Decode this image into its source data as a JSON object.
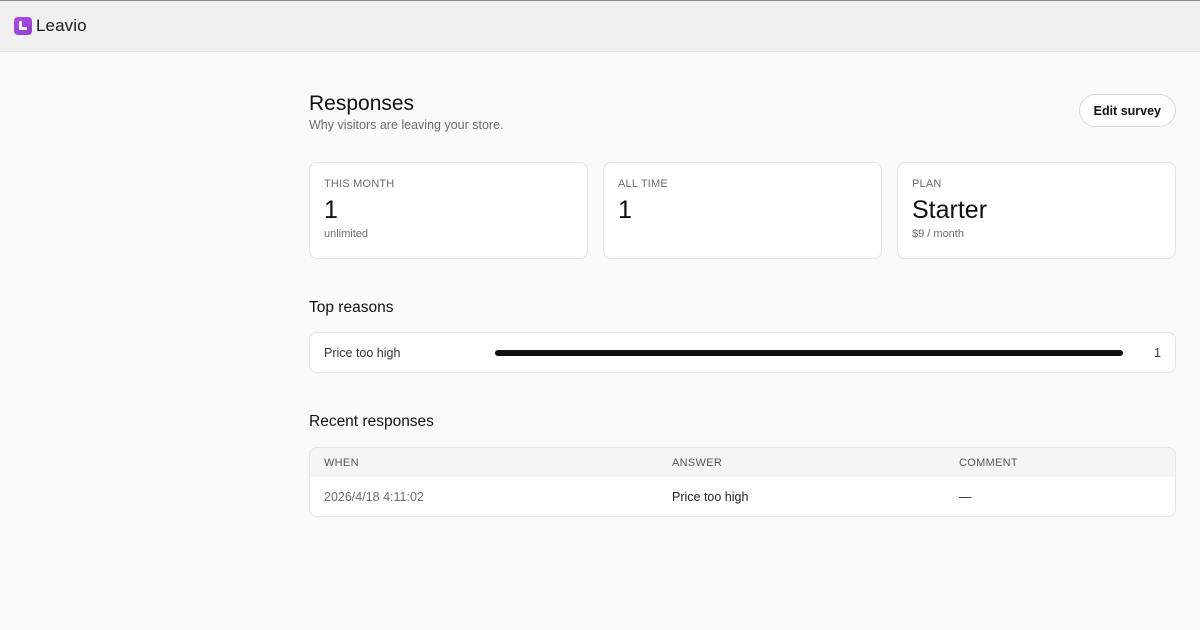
{
  "app": {
    "brand": "Leavio"
  },
  "header": {
    "title": "Responses",
    "subtitle": "Why visitors are leaving your store.",
    "edit_button": "Edit survey"
  },
  "stats": [
    {
      "label": "THIS MONTH",
      "value": "1",
      "note": "unlimited"
    },
    {
      "label": "ALL TIME",
      "value": "1",
      "note": ""
    },
    {
      "label": "PLAN",
      "value": "Starter",
      "note": "$9 / month"
    }
  ],
  "top_reasons": {
    "title": "Top reasons",
    "items": [
      {
        "label": "Price too high",
        "count": "1",
        "fraction": 1.0
      }
    ]
  },
  "recent": {
    "title": "Recent responses",
    "columns": {
      "when": "WHEN",
      "answer": "ANSWER",
      "comment": "COMMENT"
    },
    "rows": [
      {
        "when": "2026/4/18 4:11:02",
        "answer": "Price too high",
        "comment": "—"
      }
    ]
  }
}
